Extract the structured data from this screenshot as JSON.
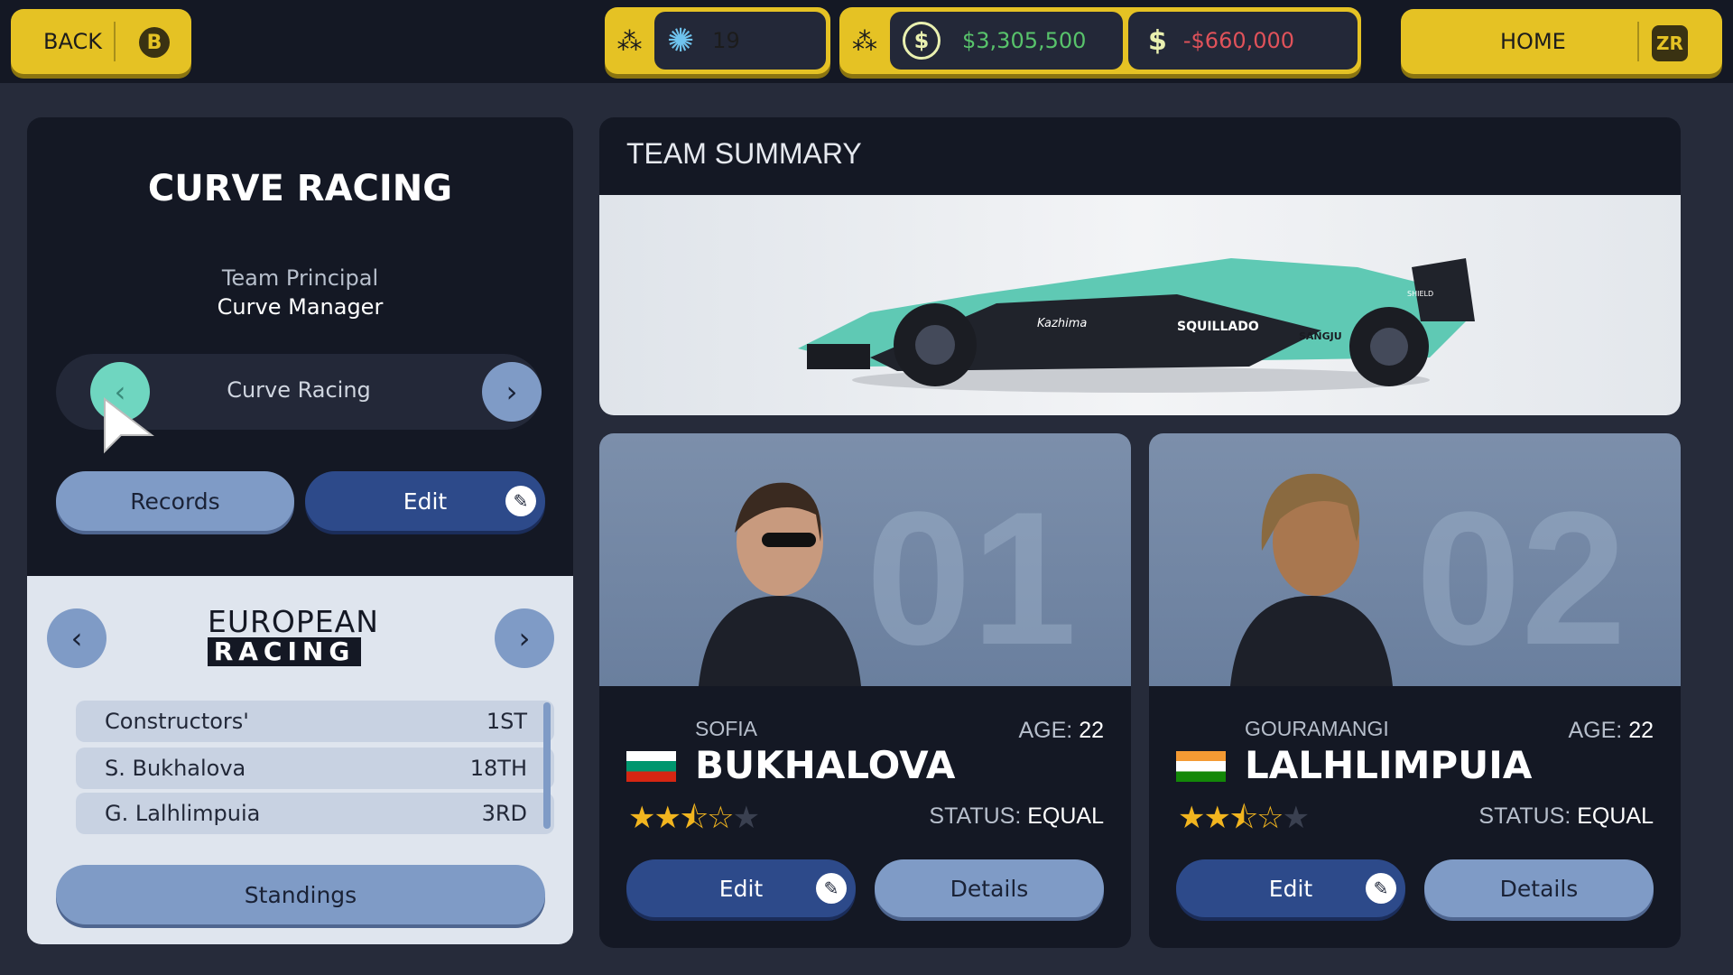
{
  "topbar": {
    "back_label": "BACK",
    "back_key": "B",
    "gems": "19",
    "money": "$3,305,500",
    "money_change": "-$660,000",
    "home_label": "HOME",
    "home_key": "ZR",
    "colors": {
      "accent": "#e5c224",
      "positive": "#58c36b",
      "negative": "#e0525a"
    }
  },
  "team": {
    "name": "CURVE RACING",
    "principal_label": "Team Principal",
    "principal_name": "Curve Manager",
    "selector_value": "Curve Racing",
    "records_label": "Records",
    "edit_label": "Edit"
  },
  "series": {
    "logo_line1": "EUROPEAN",
    "logo_line2": "RACING",
    "rows": [
      {
        "label": "Constructors'",
        "value": "1ST"
      },
      {
        "label": "S. Bukhalova",
        "value": "18TH"
      },
      {
        "label": "G. Lalhlimpuia",
        "value": "3RD"
      }
    ],
    "standings_label": "Standings"
  },
  "summary": {
    "title": "TEAM SUMMARY",
    "car_sponsors": [
      "Kazhima",
      "SQUILLADO",
      "SANGJU",
      "SHIELD"
    ]
  },
  "drivers": [
    {
      "number": "01",
      "first": "SOFIA",
      "last": "BUKHALOVA",
      "age_label": "AGE:",
      "age": "22",
      "status_label": "STATUS:",
      "status": "EQUAL",
      "rating": 2.5,
      "max_rating": 5,
      "flag": "bulgaria",
      "edit_label": "Edit",
      "details_label": "Details"
    },
    {
      "number": "02",
      "first": "GOURAMANGI",
      "last": "LALHLIMPUIA",
      "age_label": "AGE:",
      "age": "22",
      "status_label": "STATUS:",
      "status": "EQUAL",
      "rating": 2.5,
      "max_rating": 5,
      "flag": "india",
      "edit_label": "Edit",
      "details_label": "Details"
    }
  ]
}
